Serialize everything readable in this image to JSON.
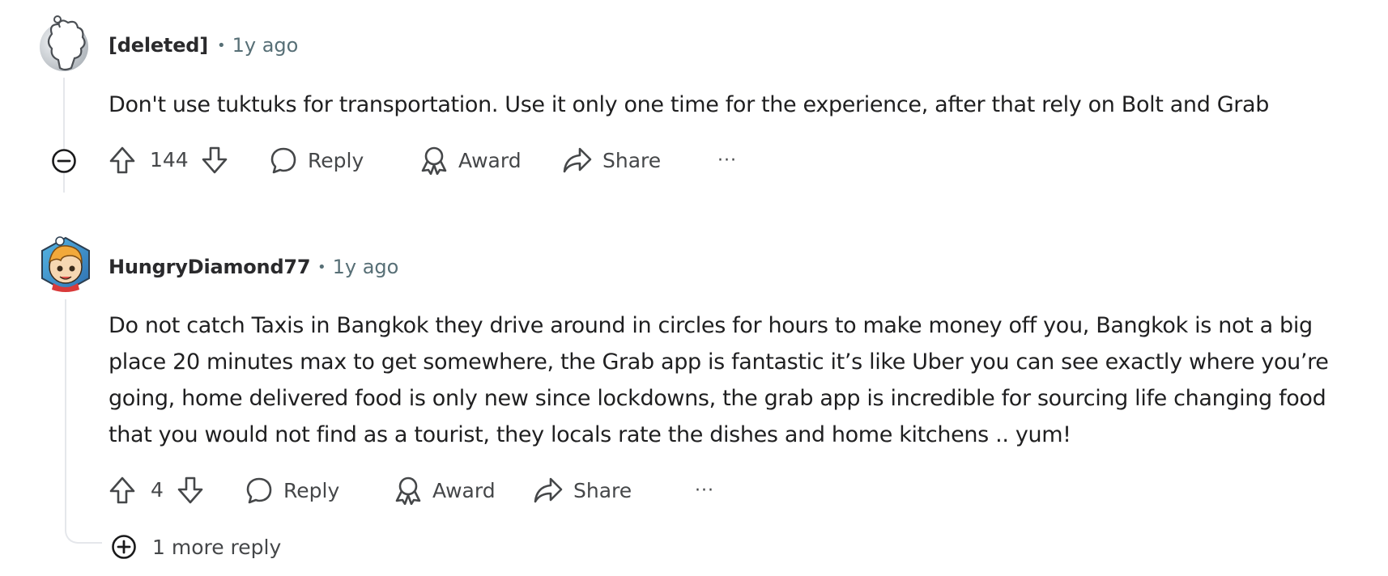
{
  "comments": [
    {
      "author": "[deleted]",
      "time": "1y ago",
      "body": "Don't use tuktuks for transportation. Use it only one time for the experience, after that rely on Bolt and Grab",
      "score": "144",
      "actions": {
        "reply": "Reply",
        "award": "Award",
        "share": "Share",
        "more": "···"
      }
    },
    {
      "author": "HungryDiamond77",
      "time": "1y ago",
      "body": "Do not catch Taxis in Bangkok they drive around in circles for hours to make money off you, Bangkok is not a big place 20 minutes max to get somewhere, the Grab app is fantastic it’s like Uber you can see exactly where you’re going, home delivered food is only new since lockdowns, the grab app is incredible for sourcing life changing food that you would not find as a tourist, they locals rate the dishes and home kitchens .. yum!",
      "score": "4",
      "actions": {
        "reply": "Reply",
        "award": "Award",
        "share": "Share",
        "more": "···"
      },
      "more_replies": "1 more reply"
    }
  ],
  "icons": {
    "upvote": "arrow-up-outline",
    "downvote": "arrow-down-outline",
    "reply": "speech-bubble",
    "award": "award-ribbon",
    "share": "share-arrow",
    "more": "ellipsis",
    "collapse": "minus-circle",
    "expand": "plus-circle"
  },
  "colors": {
    "text": "#1f1f20",
    "meta": "#576f76",
    "actions": "#454749",
    "thread_line": "#e5e7eb"
  }
}
